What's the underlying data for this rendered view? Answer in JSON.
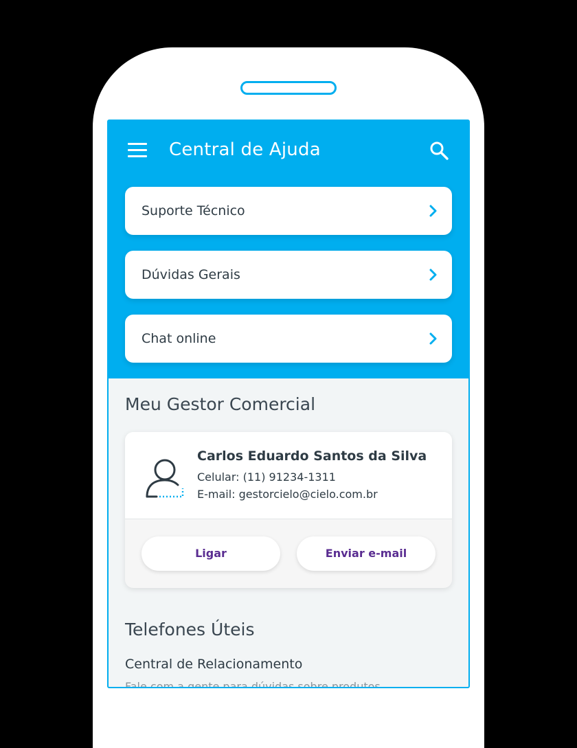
{
  "header": {
    "title": "Central de Ajuda",
    "menu_icon": "hamburger-menu-icon",
    "search_icon": "search-icon"
  },
  "menu": {
    "items": [
      {
        "label": "Suporte Técnico"
      },
      {
        "label": "Dúvidas Gerais"
      },
      {
        "label": "Chat online"
      }
    ]
  },
  "gestor": {
    "section_title": "Meu Gestor Comercial",
    "name": "Carlos Eduardo Santos da Silva",
    "phone": "Celular: (11) 91234-1311",
    "email": "E-mail: gestorcielo@cielo.com.br",
    "call_label": "Ligar",
    "email_button_label": "Enviar e-mail"
  },
  "telefones": {
    "section_title": "Telefones Úteis",
    "items": [
      {
        "label": "Central de Relacionamento",
        "subtitle": "Fale com a gente para dúvidas sobre produtos"
      }
    ]
  },
  "colors": {
    "brand_blue": "#00aeef",
    "button_text_purple": "#5a2d91",
    "text_dark": "#2e3b44",
    "background_light": "#f2f5f6"
  }
}
